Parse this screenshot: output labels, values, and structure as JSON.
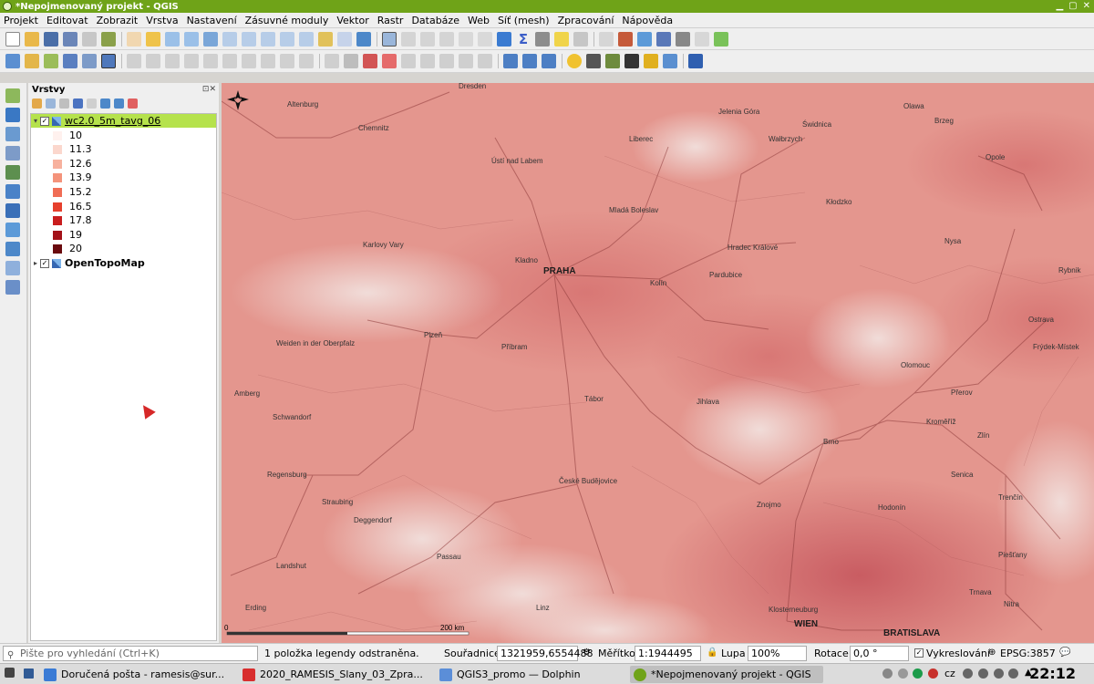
{
  "window": {
    "title": "*Nepojmenovaný projekt - QGIS"
  },
  "menu": [
    "Projekt",
    "Editovat",
    "Zobrazit",
    "Vrstva",
    "Nastavení",
    "Zásuvné moduly",
    "Vektor",
    "Rastr",
    "Databáze",
    "Web",
    "Síť (mesh)",
    "Zpracování",
    "Nápověda"
  ],
  "layers_panel": {
    "title": "Vrstvy",
    "layers": [
      {
        "name": "wc2.0_5m_tavg_06",
        "checked": true,
        "selected": true,
        "legend": [
          {
            "label": "10",
            "color": "#fff1ee"
          },
          {
            "label": "11.3",
            "color": "#fbd7cd"
          },
          {
            "label": "12.6",
            "color": "#f7b19e"
          },
          {
            "label": "13.9",
            "color": "#f4937b"
          },
          {
            "label": "15.2",
            "color": "#f06d55"
          },
          {
            "label": "16.5",
            "color": "#e6402d"
          },
          {
            "label": "17.8",
            "color": "#c91d1e"
          },
          {
            "label": "19",
            "color": "#a31118"
          },
          {
            "label": "20",
            "color": "#6a0a0e"
          }
        ]
      },
      {
        "name": "OpenTopoMap",
        "checked": true,
        "selected": false
      }
    ]
  },
  "map": {
    "cities": [
      {
        "name": "PRAHA",
        "major": true
      },
      {
        "name": "WIEN",
        "major": true
      },
      {
        "name": "BRATISLAVA",
        "major": true
      },
      {
        "name": "Dresden",
        "major": false
      },
      {
        "name": "Chemnitz",
        "major": false
      },
      {
        "name": "Altenburg",
        "major": false
      },
      {
        "name": "Liberec",
        "major": false
      },
      {
        "name": "Ústí nad Labem",
        "major": false
      },
      {
        "name": "Jelenia Góra",
        "major": false
      },
      {
        "name": "Wałbrzych",
        "major": false
      },
      {
        "name": "Świdnica",
        "major": false
      },
      {
        "name": "Olawa",
        "major": false
      },
      {
        "name": "Brzeg",
        "major": false
      },
      {
        "name": "Opole",
        "major": false
      },
      {
        "name": "Hradec Králové",
        "major": false
      },
      {
        "name": "Pardubice",
        "major": false
      },
      {
        "name": "Karlovy Vary",
        "major": false
      },
      {
        "name": "Plzeň",
        "major": false
      },
      {
        "name": "Příbram",
        "major": false
      },
      {
        "name": "Kladno",
        "major": false
      },
      {
        "name": "Mladá Boleslav",
        "major": false
      },
      {
        "name": "Kolín",
        "major": false
      },
      {
        "name": "Jihlava",
        "major": false
      },
      {
        "name": "Tábor",
        "major": false
      },
      {
        "name": "České Budějovice",
        "major": false
      },
      {
        "name": "Brno",
        "major": false
      },
      {
        "name": "Olomouc",
        "major": false
      },
      {
        "name": "Ostrava",
        "major": false
      },
      {
        "name": "Zlín",
        "major": false
      },
      {
        "name": "Přerov",
        "major": false
      },
      {
        "name": "Kroměříž",
        "major": false
      },
      {
        "name": "Regensburg",
        "major": false
      },
      {
        "name": "Straubing",
        "major": false
      },
      {
        "name": "Deggendorf",
        "major": false
      },
      {
        "name": "Passau",
        "major": false
      },
      {
        "name": "Landshut",
        "major": false
      },
      {
        "name": "Linz",
        "major": false
      },
      {
        "name": "Znojmo",
        "major": false
      },
      {
        "name": "Trenčín",
        "major": false
      },
      {
        "name": "Nitra",
        "major": false
      },
      {
        "name": "Trnava",
        "major": false
      },
      {
        "name": "Amberg",
        "major": false
      },
      {
        "name": "Schwandorf",
        "major": false
      },
      {
        "name": "Weiden in der Oberpfalz",
        "major": false
      },
      {
        "name": "Kłodzko",
        "major": false
      },
      {
        "name": "Nysa",
        "major": false
      },
      {
        "name": "Rybnik",
        "major": false
      },
      {
        "name": "Frýdek-Místek",
        "major": false
      },
      {
        "name": "Erding",
        "major": false
      },
      {
        "name": "Klosterneuburg",
        "major": false
      },
      {
        "name": "Hodonín",
        "major": false
      },
      {
        "name": "Piešťany",
        "major": false
      },
      {
        "name": "Senica",
        "major": false
      }
    ],
    "scale_text": "200 km",
    "scale_zero": "0"
  },
  "statusbar": {
    "search_placeholder": "Pište pro vyhledání (Ctrl+K)",
    "message": "1 položka legendy odstraněna.",
    "coord_label": "Souřadnice",
    "coord_value": "1321959,6554488",
    "scale_label": "Měřítko",
    "scale_value": "1:1944495",
    "magnifier_label": "Lupa",
    "magnifier_value": "100%",
    "rotation_label": "Rotace",
    "rotation_value": "0,0 °",
    "render_label": "Vykreslování",
    "crs": "EPSG:3857"
  },
  "taskbar": {
    "tasks": [
      "Doručená pošta - ramesis@sur...",
      "2020_RAMESIS_Slany_03_Zpra...",
      "QGIS3_promo — Dolphin",
      "*Nepojmenovaný projekt - QGIS"
    ],
    "lang": "cz",
    "time": "22:12"
  },
  "colors": {
    "accent": "#6fa318",
    "selection": "#b5e24c",
    "map_base": "#e4968e"
  },
  "icons": [
    "new-project-icon",
    "open-icon",
    "save-icon",
    "pan-icon",
    "zoom-in-icon",
    "zoom-out-icon",
    "identify-icon",
    "measure-icon",
    "sum-icon",
    "python-icon"
  ]
}
